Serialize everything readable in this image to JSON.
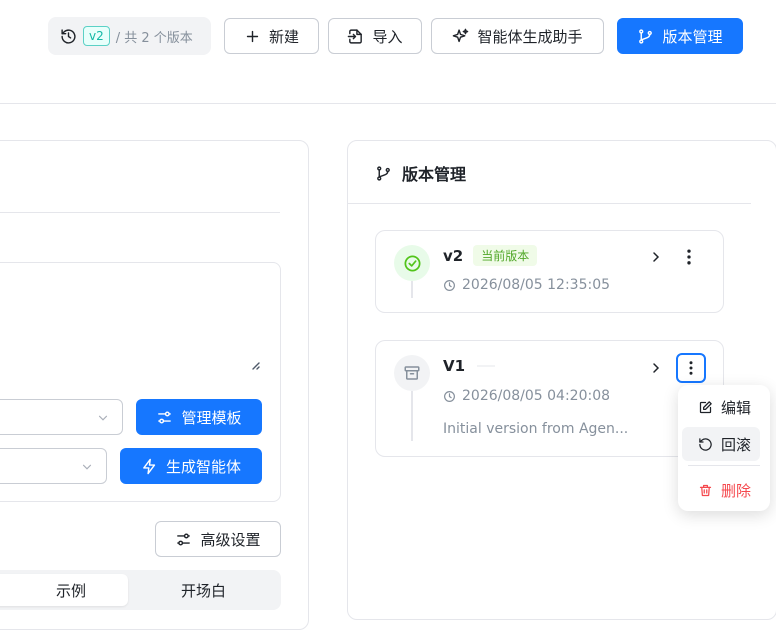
{
  "header": {
    "version_badge": "v2",
    "version_total": "/ 共 2 个版本",
    "new_label": "新建",
    "import_label": "导入",
    "assistant_label": "智能体生成助手",
    "version_mgmt_label": "版本管理"
  },
  "left": {
    "manage_template_label": "管理模板",
    "generate_agent_label": "生成智能体",
    "advanced_settings_label": "高级设置",
    "tabs": [
      "示例",
      "开场白"
    ]
  },
  "version_panel": {
    "title": "版本管理",
    "versions": [
      {
        "name": "v2",
        "badge": "当前版本",
        "time": "2026/08/05 12:35:05"
      },
      {
        "name": "V1",
        "time": "2026/08/05 04:20:08",
        "description": "Initial version from Agen..."
      }
    ]
  },
  "context_menu": {
    "edit_label": "编辑",
    "rollback_label": "回滚",
    "delete_label": "删除"
  },
  "colors": {
    "primary": "#1677ff",
    "success": "#52c41a",
    "danger": "#f5484d",
    "teal": "#14b8a6"
  }
}
